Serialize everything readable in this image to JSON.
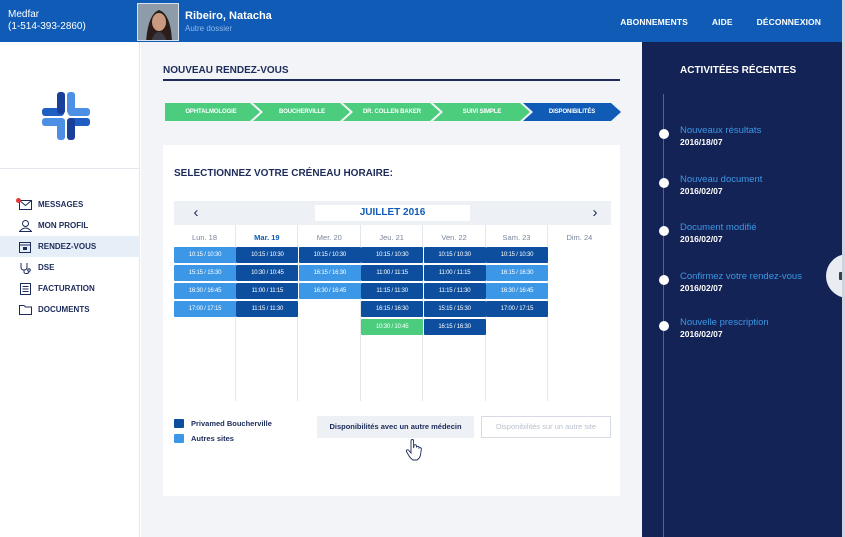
{
  "header": {
    "brand_name": "Medfar",
    "brand_phone": "(1-514-393-2860)",
    "patient_name": "Ribeiro, Natacha",
    "patient_sub": "Autre dossier",
    "nav": [
      "ABONNEMENTS",
      "AIDE",
      "DÉCONNEXION"
    ]
  },
  "sidebar": {
    "items": [
      {
        "label": "MESSAGES",
        "icon": "envelope-icon"
      },
      {
        "label": "MON PROFIL",
        "icon": "user-icon"
      },
      {
        "label": "RENDEZ-VOUS",
        "icon": "calendar-icon",
        "active": true
      },
      {
        "label": "DSE",
        "icon": "stethoscope-icon"
      },
      {
        "label": "FACTURATION",
        "icon": "document-icon"
      },
      {
        "label": "DOCUMENTS",
        "icon": "folder-icon"
      }
    ]
  },
  "main": {
    "title": "NOUVEAU RENDEZ-VOUS",
    "steps": [
      "OPHTALMOLOGIE",
      "BOUCHERVILLE",
      "DR. COLLEN BAKER",
      "SUIVI SIMPLE",
      "DISPONIBILITÉS"
    ],
    "colors": {
      "step_done": "#4ccd7e",
      "step_current": "#0f5bb5",
      "slot_dark": "#0d4f9e",
      "slot_light": "#3c97e6",
      "slot_selected": "#4ccd7e"
    },
    "card_title": "SELECTIONNEZ VOTRE CRÉNEAU HORAIRE:",
    "month": "JUILLET 2016",
    "days": [
      {
        "name": "Lun. 18",
        "slots": [
          {
            "time": "10:15 / 10:30",
            "kind": "light"
          },
          {
            "time": "15:15 / 15:30",
            "kind": "light"
          },
          {
            "time": "16:30 / 16:45",
            "kind": "light"
          },
          {
            "time": "17:00 / 17:15",
            "kind": "light"
          }
        ]
      },
      {
        "name": "Mar. 19",
        "today": true,
        "slots": [
          {
            "time": "10:15 / 10:30",
            "kind": "dark"
          },
          {
            "time": "10:30 / 10:45",
            "kind": "dark"
          },
          {
            "time": "11:00 / 11:15",
            "kind": "dark"
          },
          {
            "time": "11:15 / 11:30",
            "kind": "dark"
          }
        ]
      },
      {
        "name": "Mer. 20",
        "slots": [
          {
            "time": "10:15 / 10:30",
            "kind": "dark"
          },
          {
            "time": "16:15 / 16:30",
            "kind": "light"
          },
          {
            "time": "16:30 / 16:45",
            "kind": "light"
          }
        ]
      },
      {
        "name": "Jeu. 21",
        "slots": [
          {
            "time": "10:15 / 10:30",
            "kind": "dark"
          },
          {
            "time": "11:00 / 11:15",
            "kind": "dark"
          },
          {
            "time": "11:15 / 11:30",
            "kind": "dark"
          },
          {
            "time": "16:15 / 16:30",
            "kind": "dark"
          },
          {
            "time": "10:30 / 10:45",
            "kind": "selected"
          }
        ]
      },
      {
        "name": "Ven. 22",
        "slots": [
          {
            "time": "10:15 / 10:30",
            "kind": "dark"
          },
          {
            "time": "11:00 / 11:15",
            "kind": "dark"
          },
          {
            "time": "11:15 / 11:30",
            "kind": "dark"
          },
          {
            "time": "15:15 / 15:30",
            "kind": "dark"
          },
          {
            "time": "16:15 / 16:30",
            "kind": "dark"
          }
        ]
      },
      {
        "name": "Sam. 23",
        "slots": [
          {
            "time": "10:15 / 10:30",
            "kind": "dark"
          },
          {
            "time": "16:15 / 16:30",
            "kind": "light"
          },
          {
            "time": "16:30 / 16:45",
            "kind": "light"
          },
          {
            "time": "17:00 / 17:15",
            "kind": "dark"
          }
        ]
      },
      {
        "name": "Dim. 24",
        "slots": []
      }
    ],
    "legend": {
      "dark": "Privamed Boucherville",
      "light": "Autres sites"
    },
    "btn_other_doctor": "Disponibilités avec un autre médecin",
    "btn_other_site": "Disponibilités sur un autre site"
  },
  "recent": {
    "title": "ACTIVITÉES RÉCENTES",
    "events": [
      {
        "title": "Nouveaux résultats",
        "date": "2016/18/07"
      },
      {
        "title": "Nouveau document",
        "date": "2016/02/07"
      },
      {
        "title": "Document modifié",
        "date": "2016/02/07"
      },
      {
        "title": "Confirmez votre rendez-vous",
        "date": "2016/02/07"
      },
      {
        "title": "Nouvelle prescription",
        "date": "2016/02/07"
      }
    ]
  }
}
